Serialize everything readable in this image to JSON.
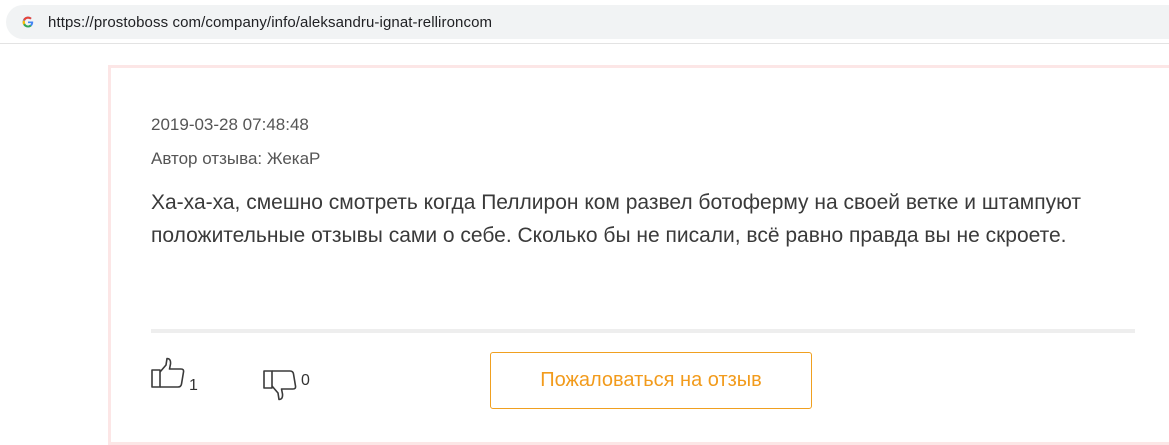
{
  "browser": {
    "url": "https://prostoboss com/company/info/aleksandru-ignat-rellironcom",
    "favicon": "google-g-icon"
  },
  "review": {
    "date": "2019-03-28 07:48:48",
    "author": "Автор отзыва: ЖекаР",
    "text": "Ха-ха-ха, смешно смотреть когда Пеллирон ком развел ботоферму на своей ветке и штампуют положительные отзывы сами о себе. Сколько бы не писали, всё равно правда вы не скроете.",
    "likes": "1",
    "dislikes": "0",
    "complain_label": "Пожаловаться на отзыв"
  },
  "colors": {
    "accent": "#f29b1c",
    "card_border": "#fce6e6"
  }
}
